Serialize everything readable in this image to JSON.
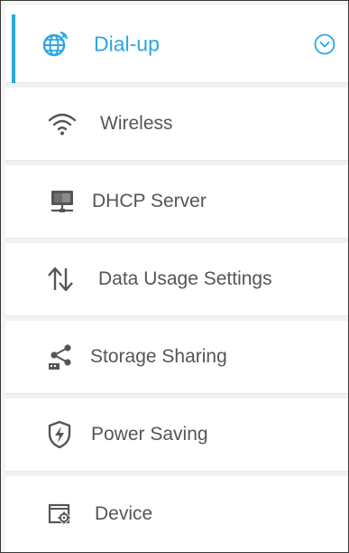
{
  "menu": {
    "items": [
      {
        "label": "Dial-up",
        "icon": "globe-icon",
        "active": true,
        "accent_color": "#2aa6e3"
      },
      {
        "label": "Wireless",
        "icon": "wifi-icon",
        "active": false
      },
      {
        "label": "DHCP Server",
        "icon": "dhcp-server-icon",
        "active": false
      },
      {
        "label": "Data Usage Settings",
        "icon": "up-down-arrows-icon",
        "active": false
      },
      {
        "label": "Storage Sharing",
        "icon": "share-icon",
        "active": false
      },
      {
        "label": "Power Saving",
        "icon": "power-saving-shield-icon",
        "active": false
      },
      {
        "label": "Device",
        "icon": "device-settings-icon",
        "active": false
      }
    ],
    "expand_icon": "chevron-down-circle-icon"
  }
}
